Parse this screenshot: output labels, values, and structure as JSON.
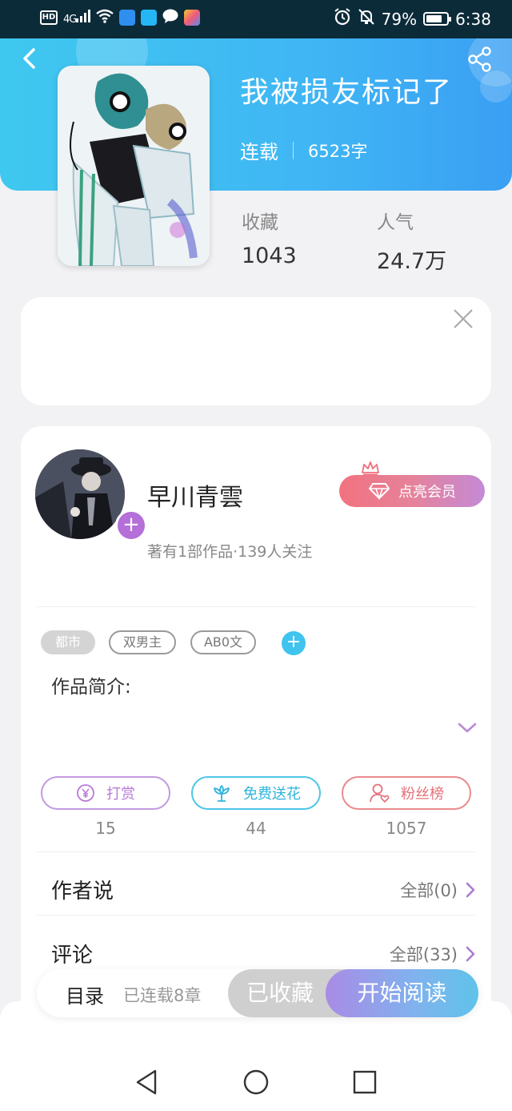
{
  "status_bar": {
    "hd": "HD",
    "signal": "4G",
    "battery_percent": "79%",
    "battery_level": 0.79,
    "time": "6:38"
  },
  "book": {
    "title": "我被损友标记了",
    "status": "连载",
    "word_count": "6523字",
    "favorites_label": "收藏",
    "favorites_value": "1043",
    "popularity_label": "人气",
    "popularity_value": "24.7万"
  },
  "author": {
    "name": "早川青雲",
    "info": "著有1部作品·139人关注",
    "vip_button": "点亮会员"
  },
  "tags": [
    {
      "label": "都市"
    },
    {
      "label": "双男主"
    },
    {
      "label": "AB0文"
    }
  ],
  "intro_label": "作品简介:",
  "actions": [
    {
      "label": "打赏",
      "count": "15",
      "icon": "yen-coin-icon"
    },
    {
      "label": "免费送花",
      "count": "44",
      "icon": "flower-icon"
    },
    {
      "label": "粉丝榜",
      "count": "1057",
      "icon": "fans-heart-icon"
    }
  ],
  "sections": {
    "author_says": {
      "title": "作者说",
      "link": "全部(0)"
    },
    "comments": {
      "title": "评论",
      "link": "全部(33)"
    }
  },
  "bottom_bar": {
    "toc": "目录",
    "chapters": "已连载8章",
    "collected": "已收藏",
    "start_read": "开始阅读"
  },
  "colors": {
    "header_gradient": [
      "#3fc8ef",
      "#3a9ff3"
    ],
    "accent_purple": "#b46fd8",
    "accent_cyan": "#3ec4ee",
    "accent_red": "#e4707a"
  }
}
